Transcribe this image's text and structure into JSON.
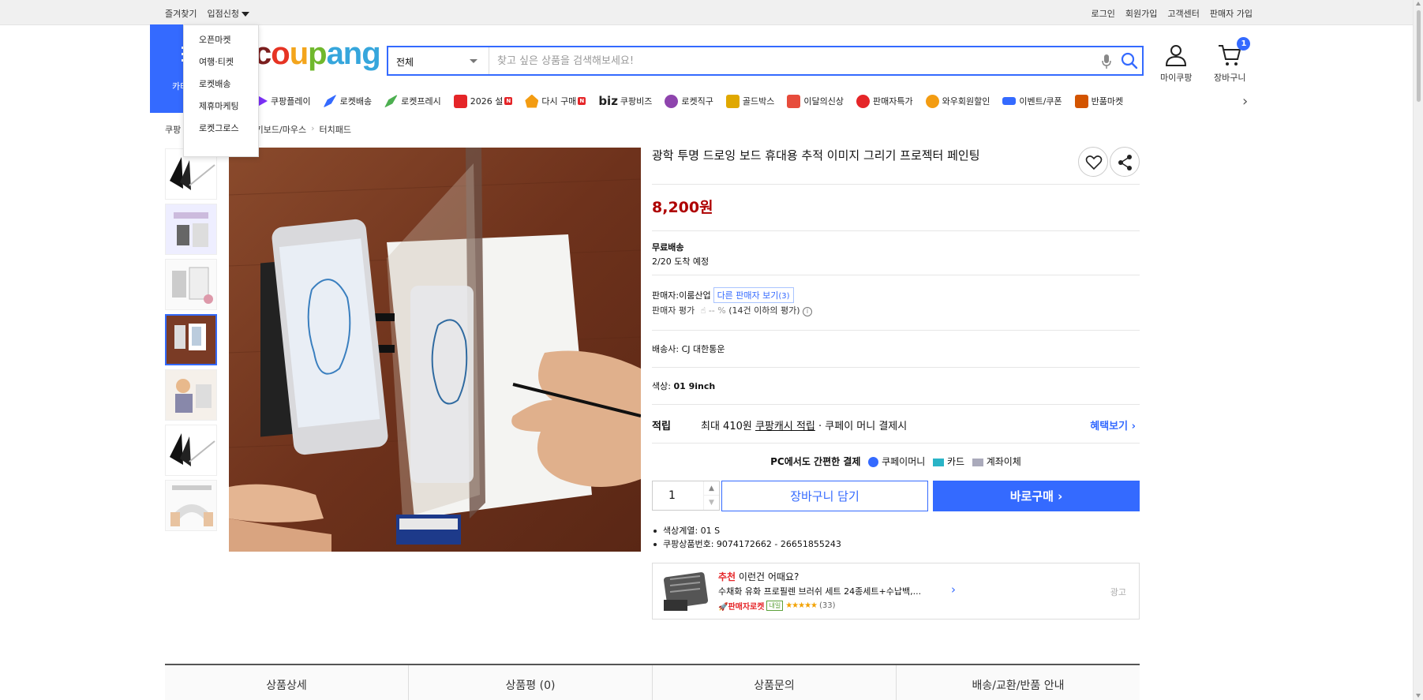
{
  "topbar": {
    "left": [
      "즐겨찾기",
      "입점신청"
    ],
    "right": [
      "로그인",
      "회원가입",
      "고객센터",
      "판매자 가입"
    ]
  },
  "dropdown": [
    "오픈마켓",
    "여행·티켓",
    "로켓배송",
    "제휴마케팅",
    "로켓그로스"
  ],
  "header": {
    "category_label": "카테고리",
    "logo": [
      "c",
      "o",
      "u",
      "p",
      "ang"
    ],
    "search_category": "전체",
    "search_placeholder": "찾고 싶은 상품을 검색해보세요!",
    "mycoupang": "마이쿠팡",
    "cart": "장바구니",
    "cart_count": "1"
  },
  "nav": [
    {
      "label": "쿠팡플레이",
      "icon": "play-icon",
      "color": "#7b2ff7"
    },
    {
      "label": "로켓배송",
      "icon": "rocket-icon",
      "color": "#346aff"
    },
    {
      "label": "로켓프레시",
      "icon": "fresh-rocket-icon",
      "color": "#4caf50"
    },
    {
      "label": "2026 설",
      "icon": "gift-icon",
      "color": "#e52528",
      "badge": "N"
    },
    {
      "label": "다시 구매",
      "icon": "repurchase-icon",
      "color": "#f39c12",
      "badge": "N"
    },
    {
      "label": "쿠팡비즈",
      "icon": "biz-icon",
      "color": "#222222",
      "prefix": "biz"
    },
    {
      "label": "로켓직구",
      "icon": "global-rocket-icon",
      "color": "#8e44ad"
    },
    {
      "label": "골드박스",
      "icon": "goldbox-icon",
      "color": "#e0a800"
    },
    {
      "label": "이달의신상",
      "icon": "new-bag-icon",
      "color": "#e74c3c"
    },
    {
      "label": "판매자특가",
      "icon": "sale-icon",
      "color": "#e52528"
    },
    {
      "label": "와우회원할인",
      "icon": "wow-icon",
      "color": "#f39c12"
    },
    {
      "label": "이벤트/쿠폰",
      "icon": "coupon-icon",
      "color": "#346aff"
    },
    {
      "label": "반품마켓",
      "icon": "return-market-icon",
      "color": "#d35400"
    }
  ],
  "breadcrumb": [
    "쿠팡",
    "키보드/마우스",
    "터치패드"
  ],
  "product": {
    "title": "광학 투명 드로잉 보드 휴대용 추적 이미지 그리기 프로젝터 페인팅",
    "price": "8,200원",
    "shipping_type": "무료배송",
    "arrival": "2/20 도착 예정",
    "seller_label": "판매자:",
    "seller": "이룸산업",
    "other_sellers": "다른 판매자 보기",
    "other_sellers_count": "(3)",
    "seller_rating_label": "판매자 평가",
    "seller_rating_value": "-- %",
    "seller_rating_note": "(14건 이하의 평가)",
    "carrier_label": "배송사:",
    "carrier": "CJ 대한통운",
    "color_label": "색상:",
    "color_value": "01 9inch",
    "points_label": "적립",
    "points_text1": "최대 410원",
    "points_link": "쿠팡캐시 적립",
    "points_text2": "· 쿠페이 머니 결제시",
    "points_more": "혜택보기",
    "pay_intro": "PC에서도 간편한 결제",
    "pay_methods": [
      "쿠페이머니",
      "카드",
      "계좌이체"
    ],
    "quantity": "1",
    "add_to_cart": "장바구니 담기",
    "buy_now": "바로구매",
    "specs": [
      "색상계열: 01 S",
      "쿠팡상품번호: 9074172662 - 26651855243"
    ]
  },
  "recommendation": {
    "tag": "추천",
    "heading": "이런건 어때요?",
    "name": "수채화 유화 프로필렌 브러쉬 세트 24종세트+수납백,...",
    "badge": "판매자로켓",
    "day": "내일",
    "stars": "★★★★★",
    "count": "(33)",
    "ad": "광고"
  },
  "tabs": [
    "상품상세",
    "상품평 (0)",
    "상품문의",
    "배송/교환/반품 안내"
  ],
  "colors": {
    "accent": "#346aff",
    "price": "#ae0000"
  }
}
